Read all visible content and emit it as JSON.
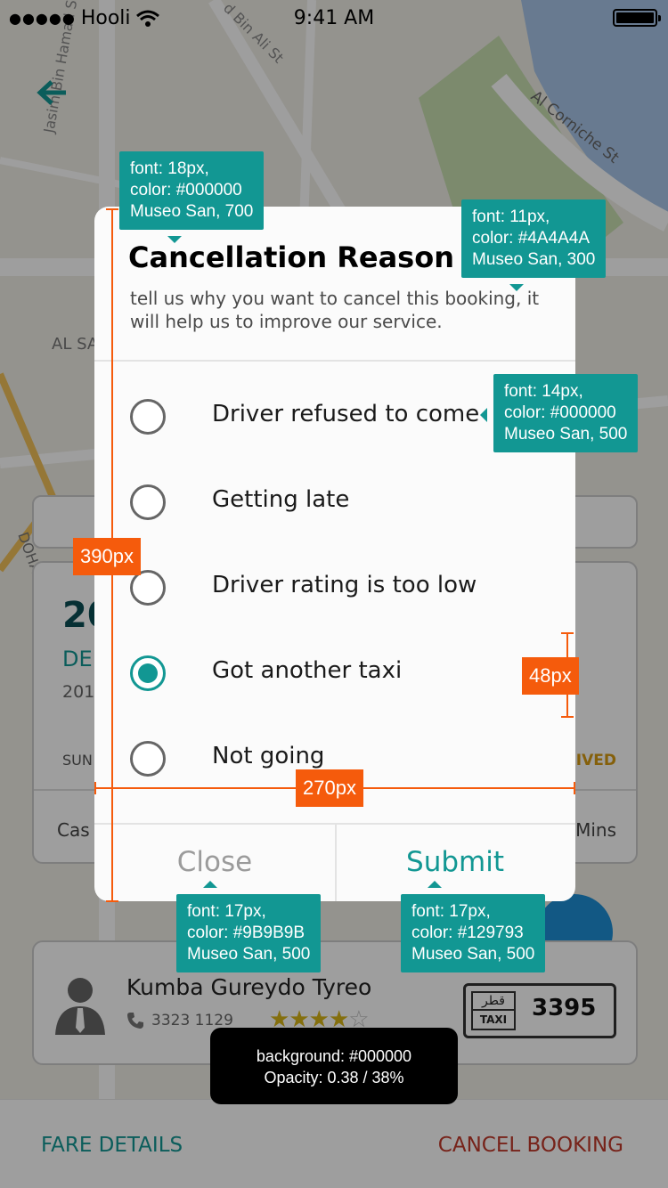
{
  "status_bar": {
    "carrier": "Hooli",
    "time": "9:41 AM"
  },
  "map": {
    "street_labels": [
      "Jasim Bin Hamad St",
      "d Bin Ali St",
      "Al Corniche St",
      "AL SA",
      "DOHA"
    ]
  },
  "trip_card": {
    "big_date": "20",
    "month": "DE",
    "year": "201",
    "day": "SUN",
    "status": "IVED",
    "payment": "Cas",
    "eta": "Mins"
  },
  "driver": {
    "name": "Kumba Gureydo Tyreo",
    "phone": "3323 1129",
    "rating": 4,
    "rating_max": 5,
    "plate_arabic": "قطر",
    "plate_tag": "TAXI",
    "plate_number": "3395"
  },
  "bottom_bar": {
    "fare_details": "FARE DETAILS",
    "cancel_booking": "CANCEL BOOKING"
  },
  "dialog": {
    "title": "Cancellation Reason",
    "subtitle": "tell us why you want to cancel this booking, it will help us to improve our service.",
    "options": [
      {
        "label": "Driver refused to come",
        "selected": false
      },
      {
        "label": "Getting late",
        "selected": false
      },
      {
        "label": "Driver rating is too low",
        "selected": false
      },
      {
        "label": "Got another taxi",
        "selected": true
      },
      {
        "label": "Not going",
        "selected": false
      }
    ],
    "close_label": "Close",
    "submit_label": "Submit"
  },
  "annotations": {
    "title_spec": [
      "font: 18px,",
      "color: #000000",
      "Museo San, 700"
    ],
    "subtitle_spec": [
      "font: 11px,",
      "color: #4A4A4A",
      "Museo San, 300"
    ],
    "option_spec": [
      "font: 14px,",
      "color: #000000",
      "Museo San, 500"
    ],
    "close_spec": [
      "font: 17px,",
      "color: #9B9B9B",
      "Museo San, 500"
    ],
    "submit_spec": [
      "font: 17px,",
      "color: #129793",
      "Museo San, 500"
    ],
    "height_measure": "390px",
    "row_measure": "48px",
    "width_measure": "270px",
    "overlay_spec": [
      "background: #000000",
      "Opacity: 0.38 / 38%"
    ]
  },
  "colors": {
    "accent": "#129793",
    "title": "#000000",
    "subtitle": "#4A4A4A",
    "close": "#9B9B9B",
    "measure": "#F55B0C",
    "cancel": "#C0392B"
  }
}
